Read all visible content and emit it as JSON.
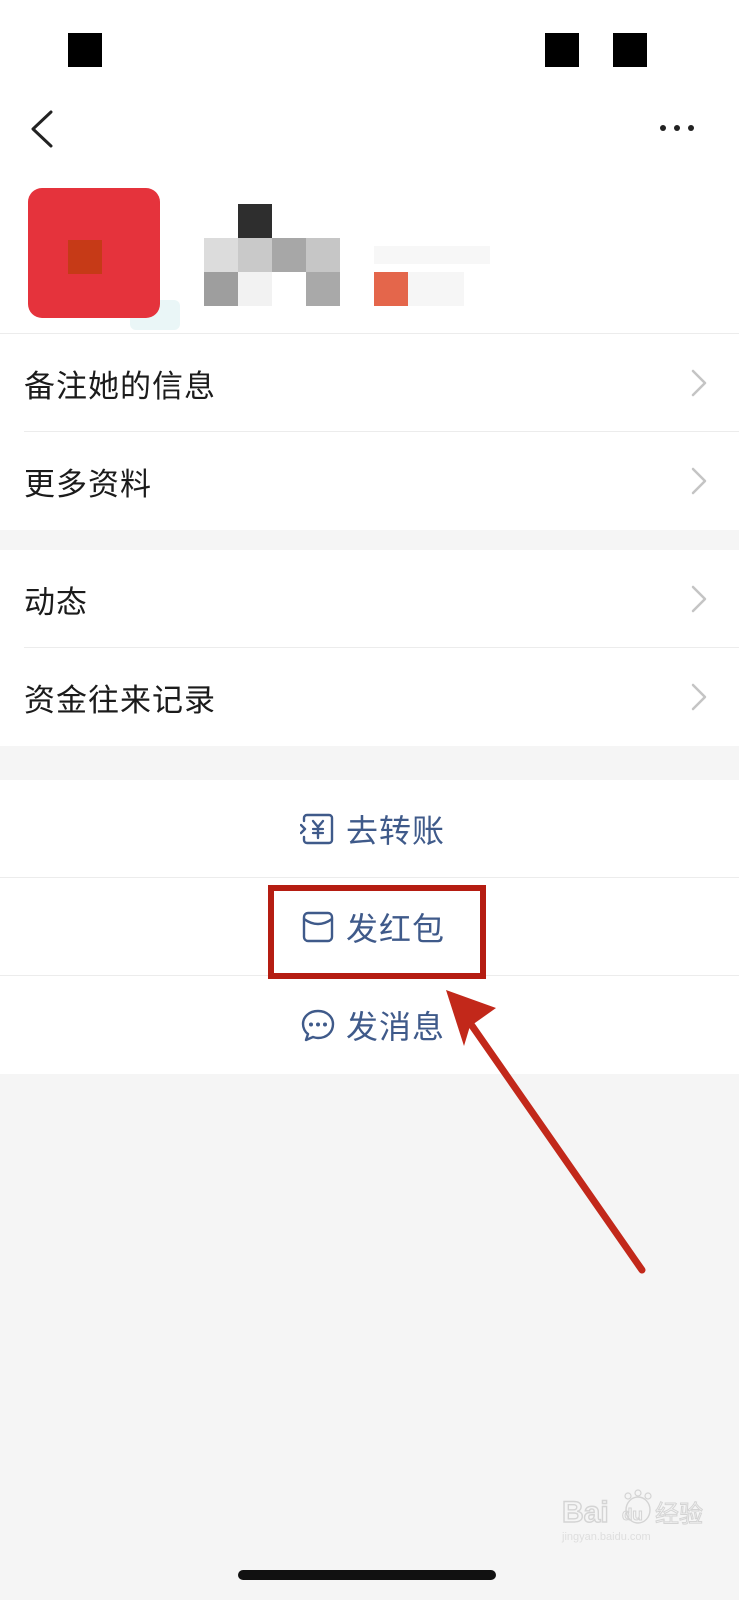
{
  "header": {
    "back_icon": "chevron-left-icon",
    "more_icon": "more-horizontal-icon"
  },
  "menu_group_1": [
    {
      "label": "备注她的信息",
      "icon": "chevron-right-icon"
    },
    {
      "label": "更多资料",
      "icon": "chevron-right-icon"
    }
  ],
  "menu_group_2": [
    {
      "label": "动态",
      "icon": "chevron-right-icon"
    },
    {
      "label": "资金往来记录",
      "icon": "chevron-right-icon"
    }
  ],
  "actions": [
    {
      "label": "去转账",
      "icon": "transfer-yen-icon"
    },
    {
      "label": "发红包",
      "icon": "red-packet-icon"
    },
    {
      "label": "发消息",
      "icon": "chat-bubble-icon"
    }
  ],
  "colors": {
    "action_text": "#3f5a8a",
    "highlight": "#b51d12",
    "avatar": "#e5333c"
  }
}
